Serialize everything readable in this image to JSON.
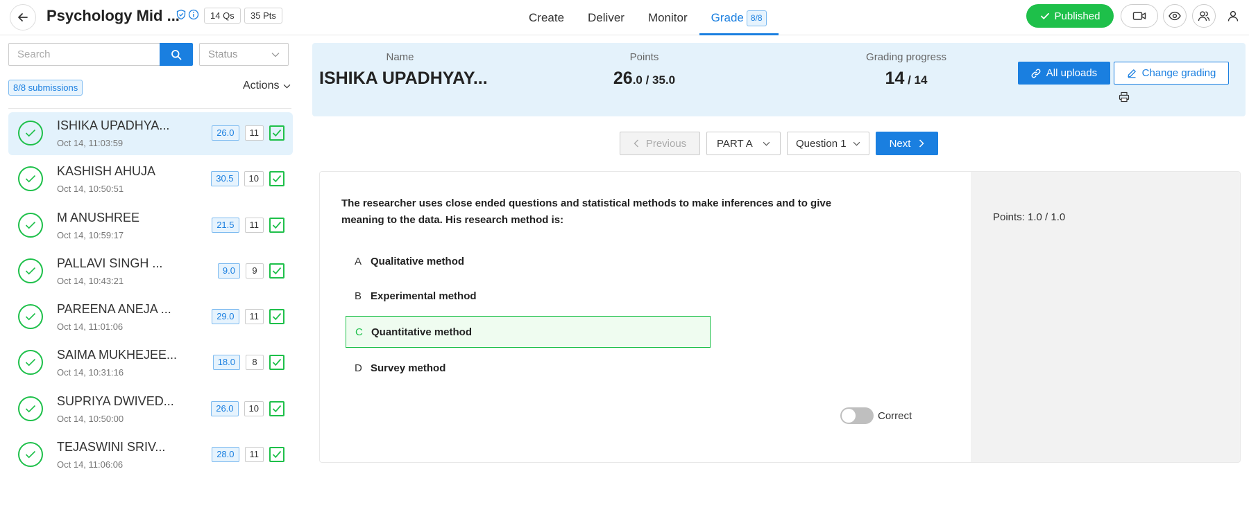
{
  "header": {
    "title": "Psychology Mid ...",
    "questions_tag": "14 Qs",
    "points_tag": "35 Pts",
    "nav": [
      {
        "label": "Create"
      },
      {
        "label": "Deliver"
      },
      {
        "label": "Monitor"
      },
      {
        "label": "Grade",
        "badge": "8/8",
        "active": true
      }
    ],
    "published_label": "Published"
  },
  "sidebar": {
    "search_placeholder": "Search",
    "status_placeholder": "Status",
    "submissions_badge": "8/8 submissions",
    "actions_label": "Actions",
    "students": [
      {
        "name": "ISHIKA UPADHYA...",
        "time": "Oct 14, 11:03:59",
        "score": "26.0",
        "count": "11"
      },
      {
        "name": "KASHISH AHUJA",
        "time": "Oct 14, 10:50:51",
        "score": "30.5",
        "count": "10"
      },
      {
        "name": "M ANUSHREE",
        "time": "Oct 14, 10:59:17",
        "score": "21.5",
        "count": "11"
      },
      {
        "name": "PALLAVI SINGH ...",
        "time": "Oct 14, 10:43:21",
        "score": "9.0",
        "count": "9"
      },
      {
        "name": "PAREENA ANEJA ...",
        "time": "Oct 14, 11:01:06",
        "score": "29.0",
        "count": "11"
      },
      {
        "name": "SAIMA MUKHEJEE...",
        "time": "Oct 14, 10:31:16",
        "score": "18.0",
        "count": "8"
      },
      {
        "name": "SUPRIYA DWIVED...",
        "time": "Oct 14, 10:50:00",
        "score": "26.0",
        "count": "10"
      },
      {
        "name": "TEJASWINI SRIV...",
        "time": "Oct 14, 11:06:06",
        "score": "28.0",
        "count": "11"
      }
    ]
  },
  "summary": {
    "name_label": "Name",
    "name_value": "ISHIKA UPADHYAY...",
    "points_label": "Points",
    "points_main": "26",
    "points_rest": ".0 / 35.0",
    "progress_label": "Grading progress",
    "progress_main": "14",
    "progress_rest": " / 14",
    "all_uploads_label": "All uploads",
    "change_grading_label": "Change grading"
  },
  "question_nav": {
    "previous_label": "Previous",
    "part_value": "PART A",
    "question_value": "Question 1",
    "next_label": "Next"
  },
  "question": {
    "text": "The researcher uses close ended questions and statistical methods to make inferences and to give meaning to the data. His research method is:",
    "points": "Points: 1.0 / 1.0",
    "options": [
      {
        "letter": "A",
        "text": "Qualitative method",
        "correct": false
      },
      {
        "letter": "B",
        "text": "Experimental method",
        "correct": false
      },
      {
        "letter": "C",
        "text": "Quantitative method",
        "correct": true
      },
      {
        "letter": "D",
        "text": "Survey method",
        "correct": false
      }
    ],
    "correct_toggle_label": "Correct",
    "correct_toggle_on": false
  },
  "colors": {
    "accent": "#1a7fe0",
    "success": "#1ec04a",
    "summary_bg": "#e4f2fb"
  }
}
